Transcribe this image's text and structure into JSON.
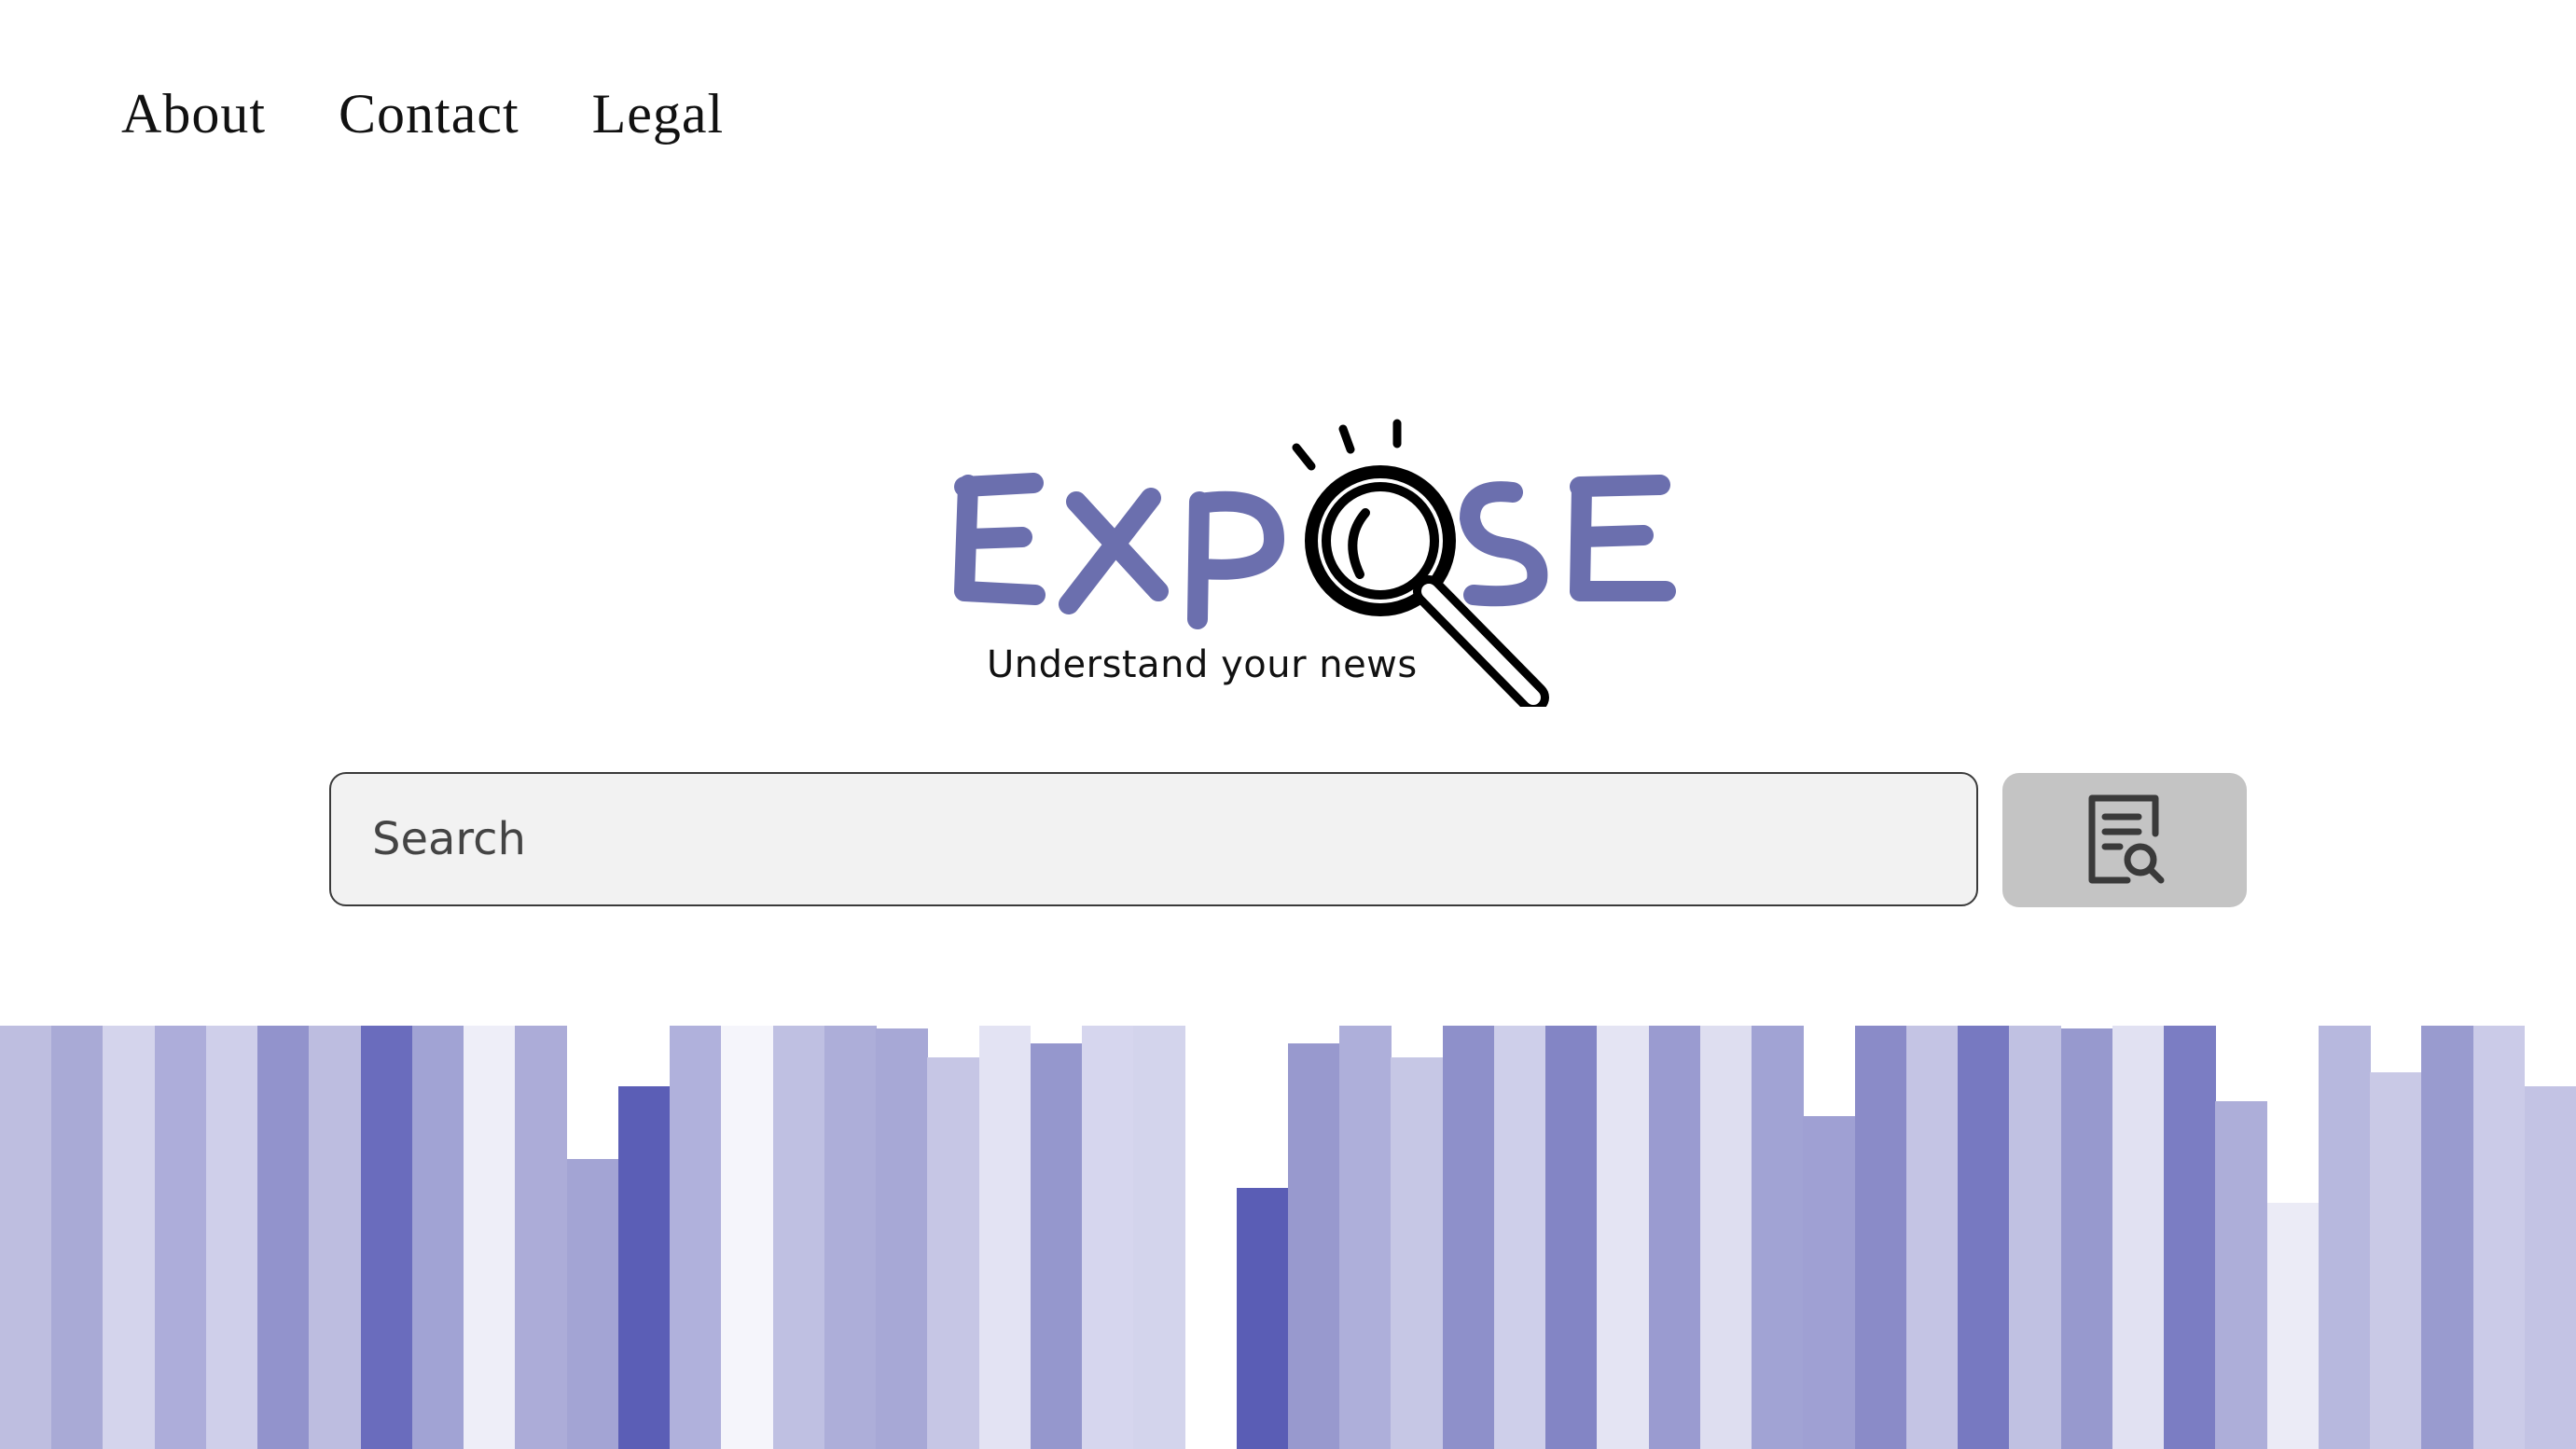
{
  "nav": {
    "items": [
      {
        "label": "About"
      },
      {
        "label": "Contact"
      },
      {
        "label": "Legal"
      }
    ]
  },
  "logo": {
    "wordmark": "EXPOSE",
    "tagline": "Understand your news",
    "color": "#6b6fae"
  },
  "search": {
    "placeholder": "Search",
    "value": "",
    "button_icon": "document-search-icon"
  },
  "decoration": {
    "name": "bar-skyline",
    "bars": [
      {
        "level": 0.4,
        "color": "#bebee0"
      },
      {
        "level": 0.4,
        "color": "#a9aad6"
      },
      {
        "level": 0.34,
        "color": "#d4d4ec"
      },
      {
        "level": 0.55,
        "color": "#adadda"
      },
      {
        "level": 0.5,
        "color": "#cfcfea"
      },
      {
        "level": 0.37,
        "color": "#9293cc"
      },
      {
        "level": 0.4,
        "color": "#bdbde0"
      },
      {
        "level": 0.39,
        "color": "#6a6cbd"
      },
      {
        "level": 0.3,
        "color": "#a1a3d4"
      },
      {
        "level": 0.42,
        "color": "#eeeef8"
      },
      {
        "level": 0.33,
        "color": "#acacd8"
      },
      {
        "level": 0.2,
        "color": "#a3a4d4"
      },
      {
        "level": 0.25,
        "color": "#5b5eb6"
      },
      {
        "level": 0.39,
        "color": "#b0b1dc"
      },
      {
        "level": 0.41,
        "color": "#f5f5fb"
      },
      {
        "level": 0.39,
        "color": "#bfc0e2"
      },
      {
        "level": 0.32,
        "color": "#adaed9"
      },
      {
        "level": 0.29,
        "color": "#a7a8d6"
      },
      {
        "level": 0.27,
        "color": "#c6c6e5"
      },
      {
        "level": 0.37,
        "color": "#e3e3f3"
      },
      {
        "level": 0.28,
        "color": "#9597cd"
      },
      {
        "level": 0.35,
        "color": "#d6d6ee"
      },
      {
        "level": 0.36,
        "color": "#d3d4ec"
      },
      {
        "level": 0.0,
        "color": "#ffffff"
      },
      {
        "level": 0.18,
        "color": "#5a5db5"
      },
      {
        "level": 0.28,
        "color": "#9899ce"
      },
      {
        "level": 0.34,
        "color": "#aeafda"
      },
      {
        "level": 0.27,
        "color": "#c6c7e5"
      },
      {
        "level": 0.47,
        "color": "#8e90ca"
      },
      {
        "level": 0.39,
        "color": "#cecfea"
      },
      {
        "level": 0.31,
        "color": "#8385c5"
      },
      {
        "level": 0.4,
        "color": "#e4e4f3"
      },
      {
        "level": 0.38,
        "color": "#9a9bd0"
      },
      {
        "level": 0.38,
        "color": "#dedef0"
      },
      {
        "level": 0.36,
        "color": "#a1a3d4"
      },
      {
        "level": 0.23,
        "color": "#9fa0d3"
      },
      {
        "level": 0.39,
        "color": "#8a8bc8"
      },
      {
        "level": 0.34,
        "color": "#c4c4e4"
      },
      {
        "level": 0.36,
        "color": "#7779c1"
      },
      {
        "level": 0.37,
        "color": "#c0c1e2"
      },
      {
        "level": 0.29,
        "color": "#9799ce"
      },
      {
        "level": 0.36,
        "color": "#e1e1f2"
      },
      {
        "level": 0.45,
        "color": "#7b7dc3"
      },
      {
        "level": 0.24,
        "color": "#adaed9"
      },
      {
        "level": 0.17,
        "color": "#ebebf6"
      },
      {
        "level": 0.31,
        "color": "#b7b8de"
      },
      {
        "level": 0.26,
        "color": "#c9c9e6"
      },
      {
        "level": 0.38,
        "color": "#999bcf"
      },
      {
        "level": 0.34,
        "color": "#cbcbe8"
      },
      {
        "level": 0.25,
        "color": "#c3c3e4"
      }
    ]
  }
}
